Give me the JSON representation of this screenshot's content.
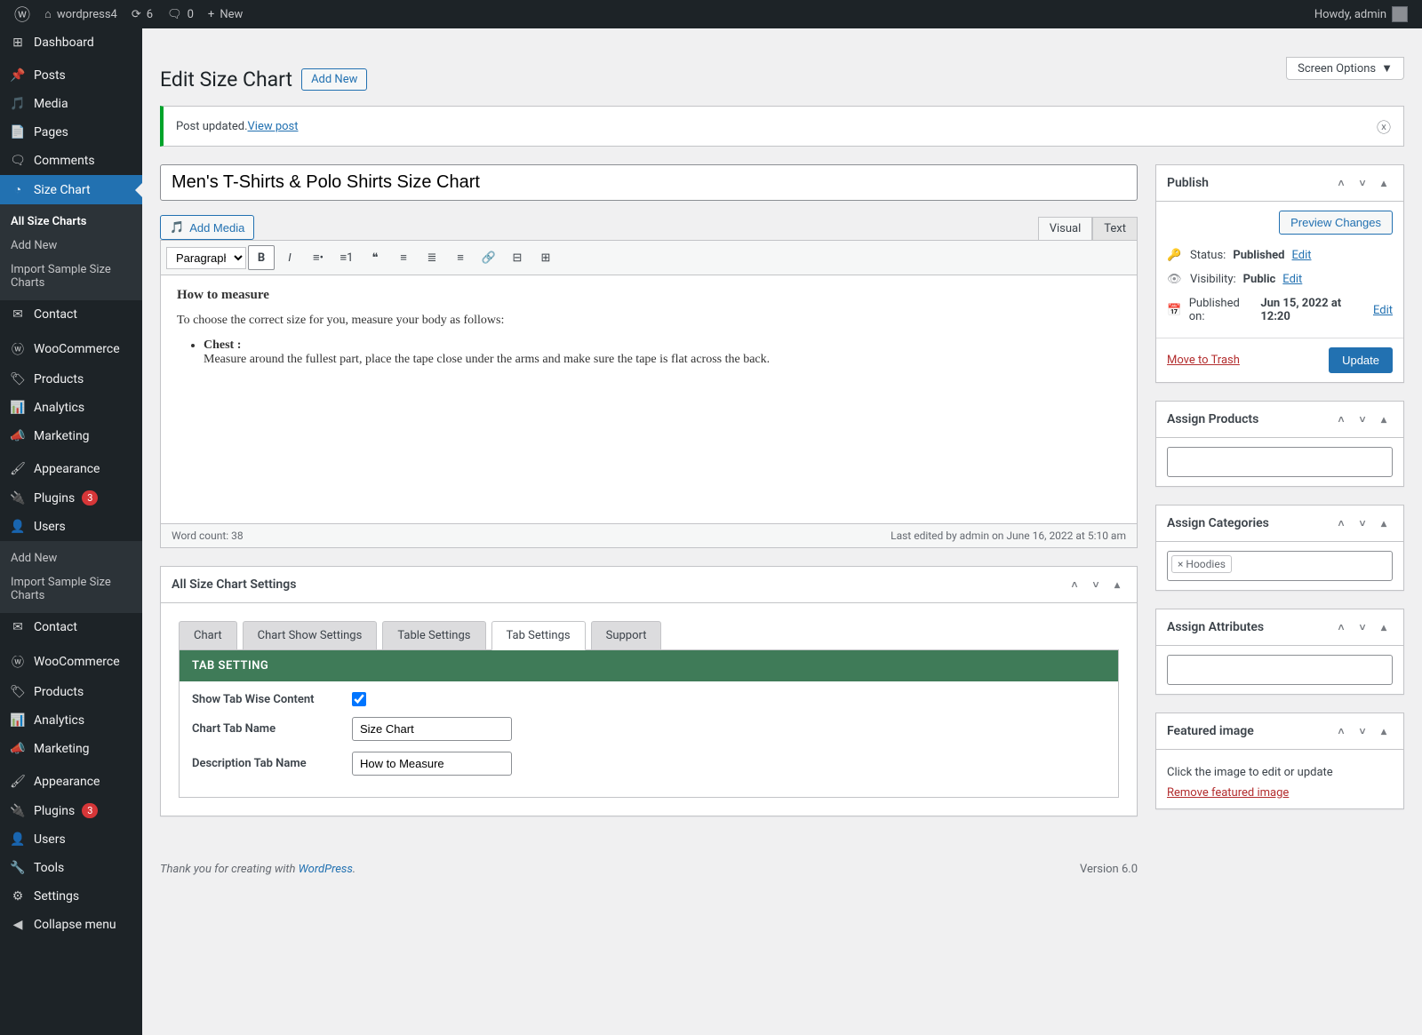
{
  "adminbar": {
    "site_name": "wordpress4",
    "updates": "6",
    "comments": "0",
    "new": "New",
    "howdy": "Howdy, admin"
  },
  "sidebar": {
    "dashboard": "Dashboard",
    "posts": "Posts",
    "media": "Media",
    "pages": "Pages",
    "comments": "Comments",
    "size_chart": "Size Chart",
    "contact": "Contact",
    "woocommerce": "WooCommerce",
    "products": "Products",
    "analytics": "Analytics",
    "marketing": "Marketing",
    "appearance": "Appearance",
    "plugins": "Plugins",
    "plugins_badge": "3",
    "users": "Users",
    "tools": "Tools",
    "settings": "Settings",
    "collapse": "Collapse menu",
    "submenu": {
      "all": "All Size Charts",
      "add_new": "Add New",
      "import": "Import Sample Size Charts"
    },
    "sub_add_new": "Add New",
    "sub_import": "Import Sample Size Charts"
  },
  "header": {
    "title": "Edit Size Chart",
    "add_new": "Add New",
    "screen_options": "Screen Options"
  },
  "notice": {
    "text": "Post updated. ",
    "link": "View post"
  },
  "post": {
    "title": "Men's T-Shirts & Polo Shirts Size Chart",
    "add_media": "Add Media",
    "tabs": {
      "visual": "Visual",
      "text": "Text"
    },
    "format_select": "Paragraph",
    "content_h": "How to measure",
    "content_p": "To choose the correct size for you, measure your body as follows:",
    "content_li_b": "Chest :",
    "content_li": "Measure around the fullest part, place the tape close under the arms and make sure the tape is flat across the back.",
    "word_count": "Word count: 38",
    "last_edit": "Last edited by admin on June 16, 2022 at 5:10 am"
  },
  "publish": {
    "title": "Publish",
    "preview": "Preview Changes",
    "status_label": "Status:",
    "status_val": "Published",
    "visibility_label": "Visibility:",
    "visibility_val": "Public",
    "published_label": "Published on:",
    "published_val": "Jun 15, 2022 at 12:20",
    "edit": "Edit",
    "trash": "Move to Trash",
    "update": "Update"
  },
  "meta": {
    "assign_products": "Assign Products",
    "assign_categories": "Assign Categories",
    "cat_chip": "Hoodies",
    "assign_attributes": "Assign Attributes",
    "featured_image": "Featured image",
    "fi_click": "Click the image to edit or update",
    "fi_remove": "Remove featured image"
  },
  "settings": {
    "title": "All Size Chart Settings",
    "tabs": [
      "Chart",
      "Chart Show Settings",
      "Table Settings",
      "Tab Settings",
      "Support"
    ],
    "banner": "TAB SETTING",
    "show_tab": "Show Tab Wise Content",
    "chart_tab_name": "Chart Tab Name",
    "chart_tab_val": "Size Chart",
    "desc_tab_name": "Description Tab Name",
    "desc_tab_val": "How to Measure"
  },
  "footer": {
    "thanks": "Thank you for creating with ",
    "wp": "WordPress",
    "version": "Version 6.0"
  }
}
